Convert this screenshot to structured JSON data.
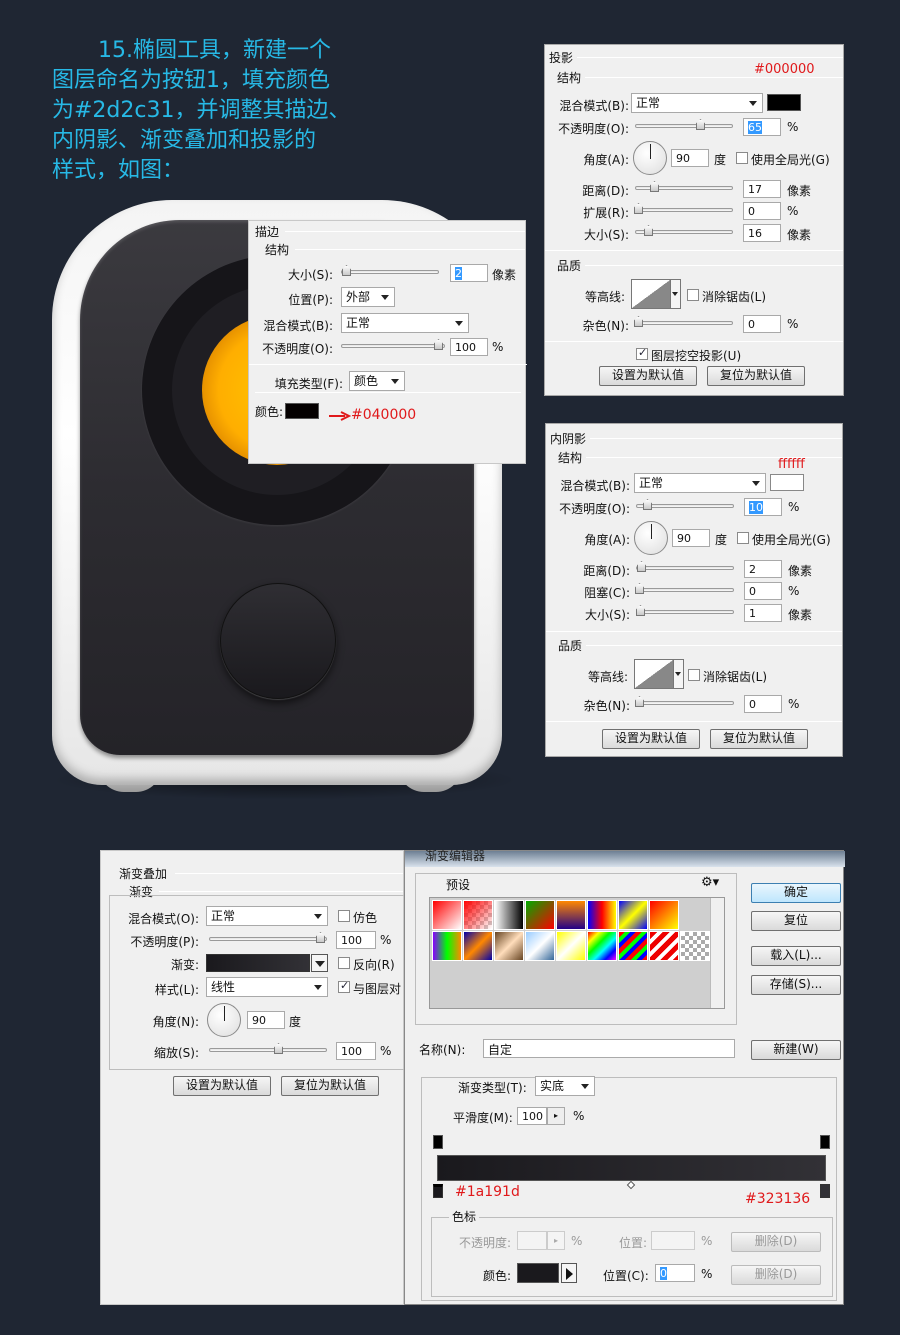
{
  "heading": {
    "line1": "15.椭圆工具，新建一个",
    "line2": "图层命名为按钮1，填充颜色",
    "line3": "为#2d2c31，并调整其描边、",
    "line4": "内阴影、渐变叠加和投影的",
    "line5": "样式，如图："
  },
  "stroke": {
    "title": "描边",
    "section": "结构",
    "size_label": "大小(S):",
    "size_value": "2",
    "size_unit": "像素",
    "position_label": "位置(P):",
    "position_value": "外部",
    "blend_label": "混合模式(B):",
    "blend_value": "正常",
    "opacity_label": "不透明度(O):",
    "opacity_value": "100",
    "opacity_unit": "%",
    "filltype_label": "填充类型(F):",
    "filltype_value": "颜色",
    "color_label": "颜色:",
    "color_swatch": "#040000",
    "annotation": "#040000"
  },
  "shadow": {
    "title": "投影",
    "section": "结构",
    "annotation": "#000000",
    "blend_label": "混合模式(B):",
    "blend_value": "正常",
    "color_swatch": "#000000",
    "opacity_label": "不透明度(O):",
    "opacity_value": "65",
    "pct": "%",
    "angle_label": "角度(A):",
    "angle_value": "90",
    "angle_unit": "度",
    "global_light": "使用全局光(G)",
    "distance_label": "距离(D):",
    "distance_value": "17",
    "px": "像素",
    "spread_label": "扩展(R):",
    "spread_value": "0",
    "size_label": "大小(S):",
    "size_value": "16",
    "quality": "品质",
    "contour_label": "等高线:",
    "antialias": "消除锯齿(L)",
    "noise_label": "杂色(N):",
    "noise_value": "0",
    "knockout": "图层挖空投影(U)",
    "set_default": "设置为默认值",
    "reset_default": "复位为默认值"
  },
  "inner_shadow": {
    "title": "内阴影",
    "section": "结构",
    "annotation": "ffffff",
    "blend_label": "混合模式(B):",
    "blend_value": "正常",
    "color_swatch": "#ffffff",
    "opacity_label": "不透明度(O):",
    "opacity_value": "10",
    "pct": "%",
    "angle_label": "角度(A):",
    "angle_value": "90",
    "angle_unit": "度",
    "global_light": "使用全局光(G)",
    "distance_label": "距离(D):",
    "distance_value": "2",
    "px": "像素",
    "choke_label": "阻塞(C):",
    "choke_value": "0",
    "size_label": "大小(S):",
    "size_value": "1",
    "quality": "品质",
    "contour_label": "等高线:",
    "antialias": "消除锯齿(L)",
    "noise_label": "杂色(N):",
    "noise_value": "0",
    "set_default": "设置为默认值",
    "reset_default": "复位为默认值"
  },
  "gradient_overlay": {
    "title": "渐变叠加",
    "section": "渐变",
    "blend_label": "混合模式(O):",
    "blend_value": "正常",
    "dither": "仿色",
    "opacity_label": "不透明度(P):",
    "opacity_value": "100",
    "pct": "%",
    "gradient_label": "渐变:",
    "reverse": "反向(R)",
    "style_label": "样式(L):",
    "style_value": "线性",
    "align": "与图层对",
    "angle_label": "角度(N):",
    "angle_value": "90",
    "angle_unit": "度",
    "scale_label": "缩放(S):",
    "scale_value": "100",
    "set_default": "设置为默认值",
    "reset_default": "复位为默认值"
  },
  "gradient_editor": {
    "title": "渐变编辑器",
    "presets_label": "预设",
    "ok": "确定",
    "cancel": "复位",
    "load": "载入(L)...",
    "save": "存储(S)...",
    "name_label": "名称(N):",
    "name_value": "自定",
    "new": "新建(W)",
    "type_label": "渐变类型(T):",
    "type_value": "实底",
    "smooth_label": "平滑度(M):",
    "smooth_value": "100",
    "pct": "%",
    "color_left": "#1a191d",
    "color_right": "#323136",
    "stops_label": "色标",
    "stop_opacity_label": "不透明度:",
    "stop_location_label": "位置:",
    "delete": "删除(D)",
    "stop_color_label": "颜色:",
    "stop_color_location_label": "位置(C):",
    "stop_color_location_value": "0"
  },
  "colors": {
    "background": "#1f2633",
    "heading": "#27b9e6",
    "annotation": "#e0191b"
  }
}
